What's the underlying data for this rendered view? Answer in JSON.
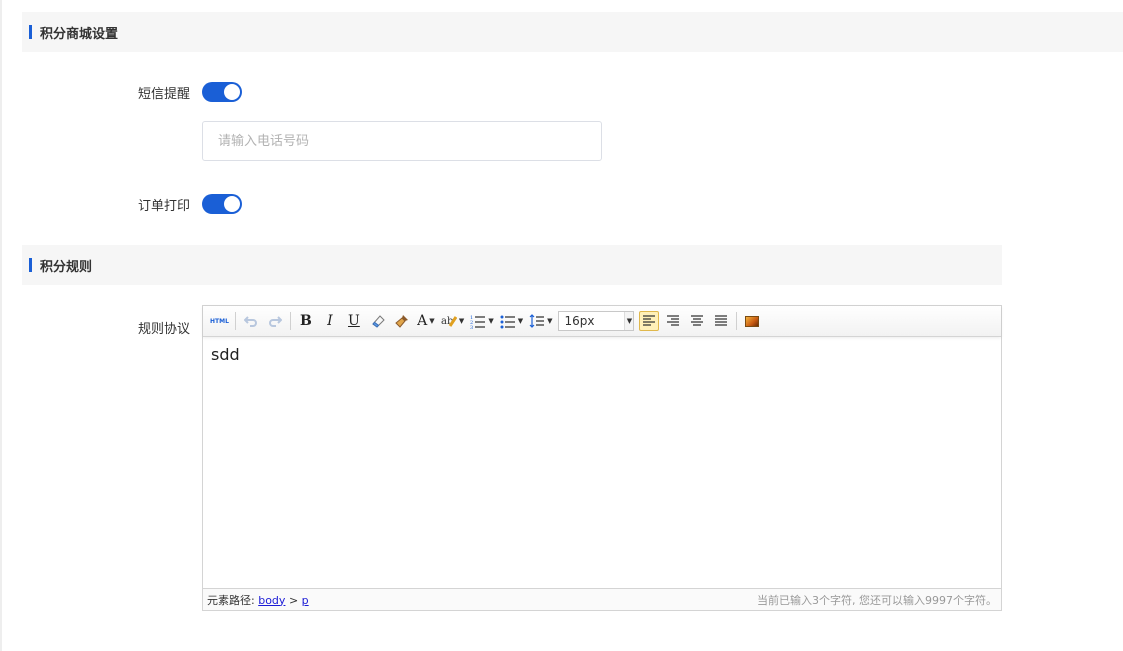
{
  "sections": {
    "points_mall_settings": "积分商城设置",
    "points_rules": "积分规则"
  },
  "form": {
    "sms_reminder_label": "短信提醒",
    "sms_reminder_on": true,
    "phone_placeholder": "请输入电话号码",
    "phone_value": "",
    "order_print_label": "订单打印",
    "order_print_on": true,
    "rules_agreement_label": "规则协议"
  },
  "editor": {
    "toolbar": {
      "html_label": "HTML",
      "bold": "B",
      "italic": "I",
      "underline": "U",
      "font_color": "A",
      "font_size": "16px",
      "icons": [
        "source-html",
        "undo",
        "redo",
        "bold",
        "italic",
        "underline",
        "eraser",
        "format-brush",
        "font-color",
        "highlight",
        "ordered-list",
        "unordered-list",
        "line-height",
        "font-size",
        "align-left",
        "align-right",
        "align-center",
        "align-justify",
        "insert-image"
      ]
    },
    "content": "sdd",
    "status": {
      "path_prefix": "元素路径:",
      "path_body": "body",
      "path_sep": ">",
      "path_p": "p",
      "char_count": "当前已输入3个字符, 您还可以输入9997个字符。"
    }
  },
  "colors": {
    "accent": "#1a5fd6",
    "section_bg": "#f6f6f6"
  }
}
